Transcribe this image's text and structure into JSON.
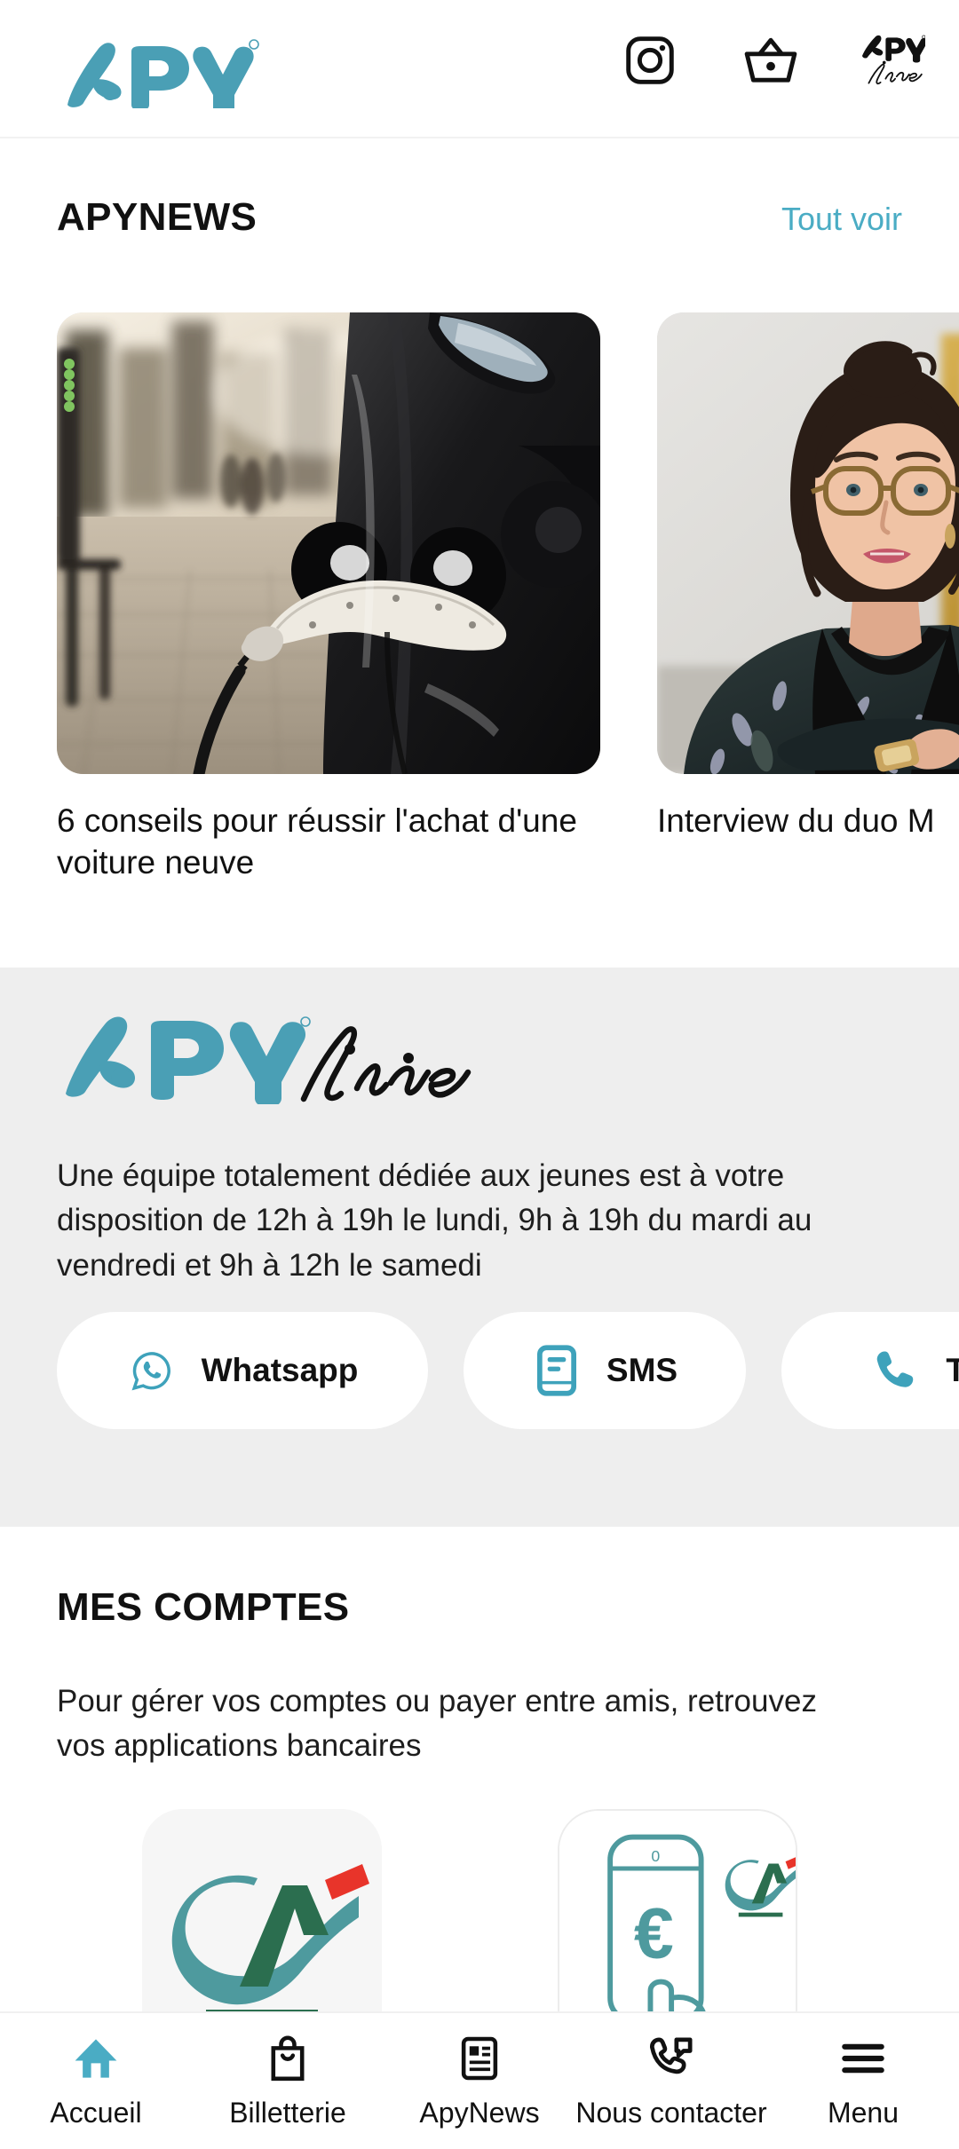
{
  "header": {
    "brand_logo_text": "APY",
    "brand_logo_mark": "apy-wordmark",
    "actions": [
      {
        "name": "instagram",
        "icon": "instagram-icon",
        "label": "Instagram"
      },
      {
        "name": "basket",
        "icon": "basket-icon",
        "label": "Panier"
      },
      {
        "name": "apyline",
        "icon": "apyline-logo-icon",
        "label": "APY line"
      }
    ]
  },
  "news": {
    "title": "APYNEWS",
    "see_all": "Tout voir",
    "cards": [
      {
        "title": "6 conseils pour réussir l'achat d'une voiture neuve",
        "image": "electric-car-charging-photo"
      },
      {
        "title": "Interview du duo M",
        "image": "woman-portrait-photo"
      }
    ]
  },
  "apyline": {
    "logo_primary": "APY",
    "logo_script": "line",
    "description": "Une équipe totalement dédiée aux jeunes est à votre disposition de 12h à 19h le lundi, 9h à 19h du mardi au vendredi et 9h à 12h le samedi",
    "contacts": [
      {
        "label": "Whatsapp",
        "icon": "whatsapp-icon"
      },
      {
        "label": "SMS",
        "icon": "sms-icon"
      },
      {
        "label": "Té",
        "icon": "phone-icon"
      }
    ]
  },
  "accounts": {
    "title": "MES COMPTES",
    "description": "Pour gérer vos comptes ou payer entre amis, retrouvez vos applications bancaires",
    "apps": [
      {
        "name": "credit-agricole",
        "icon": "credit-agricole-logo"
      },
      {
        "name": "credit-agricole-paiement",
        "icon": "mobile-euro-payment-icon"
      }
    ]
  },
  "bottom_nav": {
    "items": [
      {
        "label": "Accueil",
        "icon": "home-icon",
        "active": true
      },
      {
        "label": "Billetterie",
        "icon": "shopping-bag-icon",
        "active": false
      },
      {
        "label": "ApyNews",
        "icon": "article-icon",
        "active": false
      },
      {
        "label": "Nous contacter",
        "icon": "phone-message-icon",
        "active": false
      },
      {
        "label": "Menu",
        "icon": "hamburger-menu-icon",
        "active": false
      }
    ]
  },
  "colors": {
    "accent_teal": "#4aacc4",
    "logo_teal": "#4a9fb5",
    "grey_section": "#eeeeee",
    "text_dark": "#111111",
    "ca_green": "#2b6e4f",
    "ca_teal": "#4e9a9e",
    "ca_red": "#e8342a"
  }
}
